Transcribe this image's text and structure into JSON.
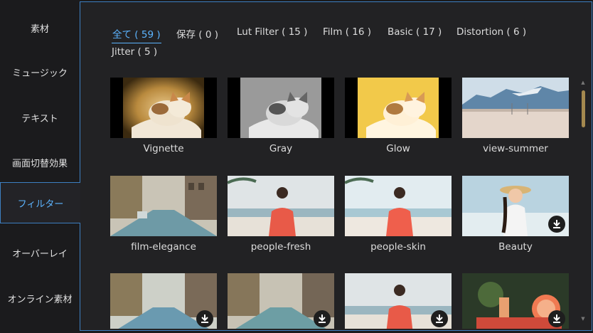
{
  "sidebar": {
    "items": [
      {
        "label": "素材"
      },
      {
        "label": "ミュージック"
      },
      {
        "label": "テキスト"
      },
      {
        "label": "画面切替効果"
      },
      {
        "label": "フィルター"
      },
      {
        "label": "オーバーレイ"
      },
      {
        "label": "オンライン素材"
      }
    ],
    "active_index": 4
  },
  "tabs": [
    {
      "label": "全て ( 59 )"
    },
    {
      "label": "保存 ( 0 )"
    },
    {
      "label": "Lut Filter ( 15 )"
    },
    {
      "label": "Film ( 16 )"
    },
    {
      "label": "Basic ( 17 )"
    },
    {
      "label": "Distortion ( 6 )"
    },
    {
      "label": "Jitter ( 5 )"
    }
  ],
  "filters": [
    {
      "name": "Vignette",
      "download": false
    },
    {
      "name": "Gray",
      "download": false
    },
    {
      "name": "Glow",
      "download": false
    },
    {
      "name": "view-summer",
      "download": false
    },
    {
      "name": "film-elegance",
      "download": false
    },
    {
      "name": "people-fresh",
      "download": false
    },
    {
      "name": "people-skin",
      "download": false
    },
    {
      "name": "Beauty",
      "download": true
    },
    {
      "name": "",
      "download": true
    },
    {
      "name": "",
      "download": true
    },
    {
      "name": "",
      "download": true
    },
    {
      "name": "",
      "download": true
    }
  ],
  "icons": {
    "download": "download-icon",
    "scroll_up": "scroll-up-icon",
    "scroll_down": "scroll-down-icon"
  },
  "colors": {
    "accent": "#5cb4ff",
    "border": "#3d7fc2",
    "scroll_thumb": "#a4894f"
  }
}
